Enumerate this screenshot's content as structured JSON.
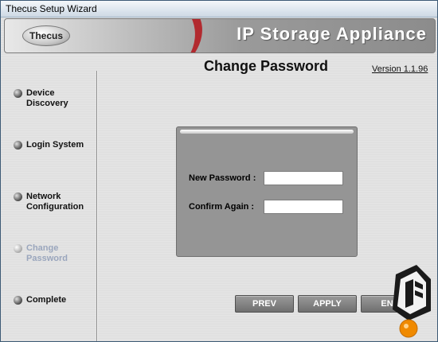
{
  "window": {
    "title": "Thecus Setup Wizard"
  },
  "banner": {
    "logo_text": "Thecus",
    "product_name": "IP Storage Appliance"
  },
  "page": {
    "title": "Change Password",
    "version": "Version 1.1.96"
  },
  "steps": [
    {
      "label": "Device Discovery",
      "state": "done"
    },
    {
      "label": "Login System",
      "state": "done"
    },
    {
      "label": "Network Configuration",
      "state": "done"
    },
    {
      "label": "Change Password",
      "state": "current"
    },
    {
      "label": "Complete",
      "state": "pending"
    }
  ],
  "form": {
    "new_password_label": "New Password :",
    "new_password_value": "",
    "confirm_label": "Confirm Again :",
    "confirm_value": ""
  },
  "buttons": {
    "prev": "PREV",
    "apply": "APPLY",
    "end": "END"
  },
  "colors": {
    "active_step": "#9aa6bd",
    "panel": "#959595",
    "button": "#6f6f6f",
    "brand_red": "#b4141b",
    "watermark_orange": "#f08a00"
  }
}
